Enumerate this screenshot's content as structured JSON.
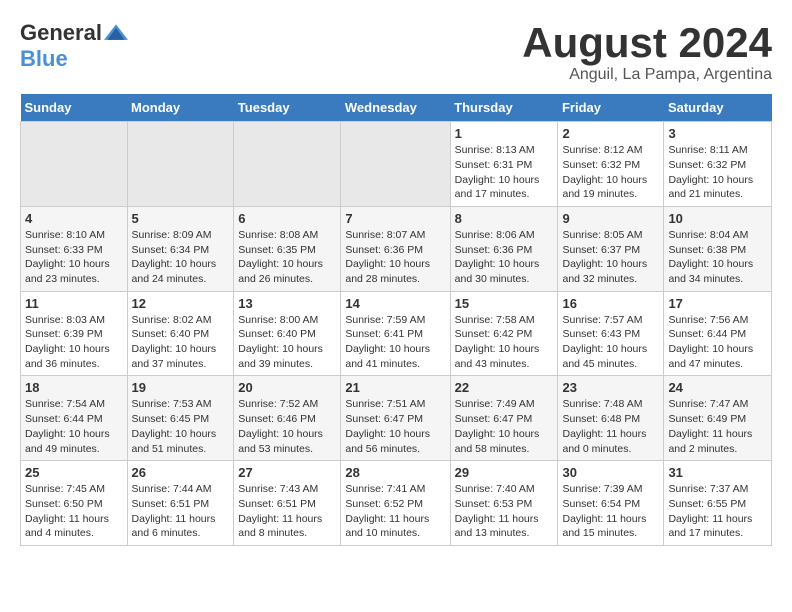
{
  "logo": {
    "general": "General",
    "blue": "Blue"
  },
  "title": {
    "month_year": "August 2024",
    "location": "Anguil, La Pampa, Argentina"
  },
  "weekdays": [
    "Sunday",
    "Monday",
    "Tuesday",
    "Wednesday",
    "Thursday",
    "Friday",
    "Saturday"
  ],
  "weeks": [
    [
      {
        "day": "",
        "sunrise": "",
        "sunset": "",
        "daylight": ""
      },
      {
        "day": "",
        "sunrise": "",
        "sunset": "",
        "daylight": ""
      },
      {
        "day": "",
        "sunrise": "",
        "sunset": "",
        "daylight": ""
      },
      {
        "day": "",
        "sunrise": "",
        "sunset": "",
        "daylight": ""
      },
      {
        "day": "1",
        "sunrise": "Sunrise: 8:13 AM",
        "sunset": "Sunset: 6:31 PM",
        "daylight": "Daylight: 10 hours and 17 minutes."
      },
      {
        "day": "2",
        "sunrise": "Sunrise: 8:12 AM",
        "sunset": "Sunset: 6:32 PM",
        "daylight": "Daylight: 10 hours and 19 minutes."
      },
      {
        "day": "3",
        "sunrise": "Sunrise: 8:11 AM",
        "sunset": "Sunset: 6:32 PM",
        "daylight": "Daylight: 10 hours and 21 minutes."
      }
    ],
    [
      {
        "day": "4",
        "sunrise": "Sunrise: 8:10 AM",
        "sunset": "Sunset: 6:33 PM",
        "daylight": "Daylight: 10 hours and 23 minutes."
      },
      {
        "day": "5",
        "sunrise": "Sunrise: 8:09 AM",
        "sunset": "Sunset: 6:34 PM",
        "daylight": "Daylight: 10 hours and 24 minutes."
      },
      {
        "day": "6",
        "sunrise": "Sunrise: 8:08 AM",
        "sunset": "Sunset: 6:35 PM",
        "daylight": "Daylight: 10 hours and 26 minutes."
      },
      {
        "day": "7",
        "sunrise": "Sunrise: 8:07 AM",
        "sunset": "Sunset: 6:36 PM",
        "daylight": "Daylight: 10 hours and 28 minutes."
      },
      {
        "day": "8",
        "sunrise": "Sunrise: 8:06 AM",
        "sunset": "Sunset: 6:36 PM",
        "daylight": "Daylight: 10 hours and 30 minutes."
      },
      {
        "day": "9",
        "sunrise": "Sunrise: 8:05 AM",
        "sunset": "Sunset: 6:37 PM",
        "daylight": "Daylight: 10 hours and 32 minutes."
      },
      {
        "day": "10",
        "sunrise": "Sunrise: 8:04 AM",
        "sunset": "Sunset: 6:38 PM",
        "daylight": "Daylight: 10 hours and 34 minutes."
      }
    ],
    [
      {
        "day": "11",
        "sunrise": "Sunrise: 8:03 AM",
        "sunset": "Sunset: 6:39 PM",
        "daylight": "Daylight: 10 hours and 36 minutes."
      },
      {
        "day": "12",
        "sunrise": "Sunrise: 8:02 AM",
        "sunset": "Sunset: 6:40 PM",
        "daylight": "Daylight: 10 hours and 37 minutes."
      },
      {
        "day": "13",
        "sunrise": "Sunrise: 8:00 AM",
        "sunset": "Sunset: 6:40 PM",
        "daylight": "Daylight: 10 hours and 39 minutes."
      },
      {
        "day": "14",
        "sunrise": "Sunrise: 7:59 AM",
        "sunset": "Sunset: 6:41 PM",
        "daylight": "Daylight: 10 hours and 41 minutes."
      },
      {
        "day": "15",
        "sunrise": "Sunrise: 7:58 AM",
        "sunset": "Sunset: 6:42 PM",
        "daylight": "Daylight: 10 hours and 43 minutes."
      },
      {
        "day": "16",
        "sunrise": "Sunrise: 7:57 AM",
        "sunset": "Sunset: 6:43 PM",
        "daylight": "Daylight: 10 hours and 45 minutes."
      },
      {
        "day": "17",
        "sunrise": "Sunrise: 7:56 AM",
        "sunset": "Sunset: 6:44 PM",
        "daylight": "Daylight: 10 hours and 47 minutes."
      }
    ],
    [
      {
        "day": "18",
        "sunrise": "Sunrise: 7:54 AM",
        "sunset": "Sunset: 6:44 PM",
        "daylight": "Daylight: 10 hours and 49 minutes."
      },
      {
        "day": "19",
        "sunrise": "Sunrise: 7:53 AM",
        "sunset": "Sunset: 6:45 PM",
        "daylight": "Daylight: 10 hours and 51 minutes."
      },
      {
        "day": "20",
        "sunrise": "Sunrise: 7:52 AM",
        "sunset": "Sunset: 6:46 PM",
        "daylight": "Daylight: 10 hours and 53 minutes."
      },
      {
        "day": "21",
        "sunrise": "Sunrise: 7:51 AM",
        "sunset": "Sunset: 6:47 PM",
        "daylight": "Daylight: 10 hours and 56 minutes."
      },
      {
        "day": "22",
        "sunrise": "Sunrise: 7:49 AM",
        "sunset": "Sunset: 6:47 PM",
        "daylight": "Daylight: 10 hours and 58 minutes."
      },
      {
        "day": "23",
        "sunrise": "Sunrise: 7:48 AM",
        "sunset": "Sunset: 6:48 PM",
        "daylight": "Daylight: 11 hours and 0 minutes."
      },
      {
        "day": "24",
        "sunrise": "Sunrise: 7:47 AM",
        "sunset": "Sunset: 6:49 PM",
        "daylight": "Daylight: 11 hours and 2 minutes."
      }
    ],
    [
      {
        "day": "25",
        "sunrise": "Sunrise: 7:45 AM",
        "sunset": "Sunset: 6:50 PM",
        "daylight": "Daylight: 11 hours and 4 minutes."
      },
      {
        "day": "26",
        "sunrise": "Sunrise: 7:44 AM",
        "sunset": "Sunset: 6:51 PM",
        "daylight": "Daylight: 11 hours and 6 minutes."
      },
      {
        "day": "27",
        "sunrise": "Sunrise: 7:43 AM",
        "sunset": "Sunset: 6:51 PM",
        "daylight": "Daylight: 11 hours and 8 minutes."
      },
      {
        "day": "28",
        "sunrise": "Sunrise: 7:41 AM",
        "sunset": "Sunset: 6:52 PM",
        "daylight": "Daylight: 11 hours and 10 minutes."
      },
      {
        "day": "29",
        "sunrise": "Sunrise: 7:40 AM",
        "sunset": "Sunset: 6:53 PM",
        "daylight": "Daylight: 11 hours and 13 minutes."
      },
      {
        "day": "30",
        "sunrise": "Sunrise: 7:39 AM",
        "sunset": "Sunset: 6:54 PM",
        "daylight": "Daylight: 11 hours and 15 minutes."
      },
      {
        "day": "31",
        "sunrise": "Sunrise: 7:37 AM",
        "sunset": "Sunset: 6:55 PM",
        "daylight": "Daylight: 11 hours and 17 minutes."
      }
    ]
  ]
}
